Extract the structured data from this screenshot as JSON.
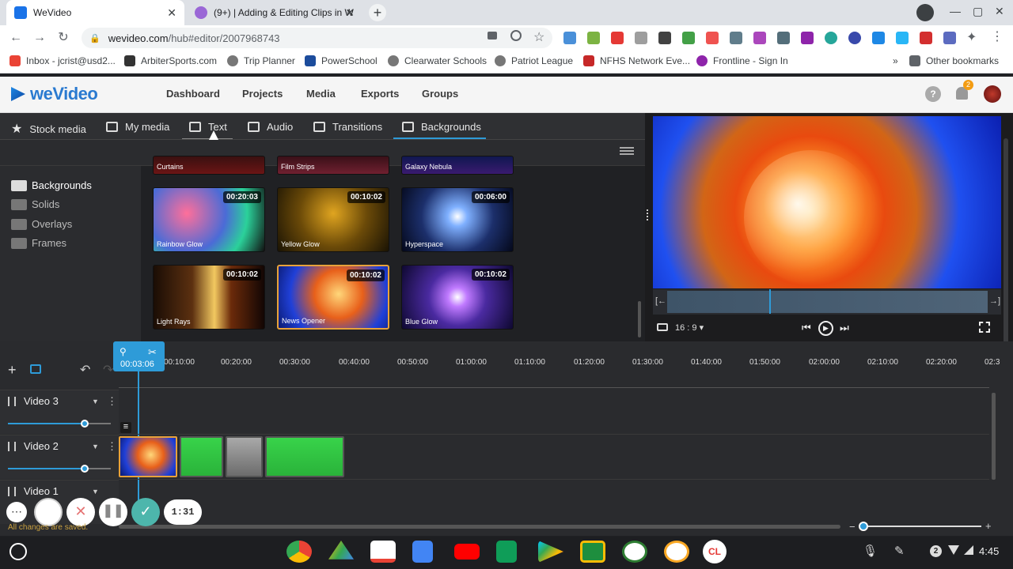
{
  "browser": {
    "tabs": [
      {
        "title": "WeVideo",
        "color": "#1a73e8"
      },
      {
        "title": "(9+) | Adding & Editing Clips in W",
        "color": "#9a67d6"
      }
    ],
    "url_host": "wevideo.com",
    "url_path": "/hub#editor/2007968743",
    "bookmarks": [
      "Inbox - jcrist@usd2...",
      "ArbiterSports.com",
      "Trip Planner",
      "PowerSchool",
      "Clearwater Schools",
      "Patriot League",
      "NFHS Network Eve...",
      "Frontline - Sign In"
    ],
    "other_bookmarks": "Other bookmarks"
  },
  "app": {
    "logo": "weVideo",
    "nav": [
      "Dashboard",
      "Projects",
      "Media",
      "Exports",
      "Groups"
    ],
    "notification_count": "2",
    "media_tabs": [
      "Stock media",
      "My media",
      "Text",
      "Audio",
      "Transitions",
      "Backgrounds"
    ],
    "folders": [
      "Backgrounds",
      "Solids",
      "Overlays",
      "Frames"
    ],
    "top_row": [
      "Curtains",
      "Film Strips",
      "Galaxy Nebula"
    ],
    "thumbs": [
      {
        "label": "Rainbow Glow",
        "dur": "00:20:03"
      },
      {
        "label": "Yellow Glow",
        "dur": "00:10:02"
      },
      {
        "label": "Hyperspace",
        "dur": "00:06:00"
      },
      {
        "label": "Light Rays",
        "dur": "00:10:02"
      },
      {
        "label": "News Opener",
        "dur": "00:10:02"
      },
      {
        "label": "Blue Glow",
        "dur": "00:10:02"
      }
    ],
    "aspect": "16 : 9"
  },
  "timeline": {
    "playhead": "00:03:06",
    "ruler": [
      "00:10:00",
      "00:20:00",
      "00:30:00",
      "00:40:00",
      "00:50:00",
      "01:00:00",
      "01:10:00",
      "01:20:00",
      "01:30:00",
      "01:40:00",
      "01:50:00",
      "02:00:00",
      "02:10:00",
      "02:20:00",
      "02:3"
    ],
    "tracks": [
      "Video 3",
      "Video 2",
      "Video 1"
    ],
    "saved": "All changes are saved.",
    "timer": "1:31"
  },
  "taskbar": {
    "badge": "2",
    "clock": "4:45"
  }
}
